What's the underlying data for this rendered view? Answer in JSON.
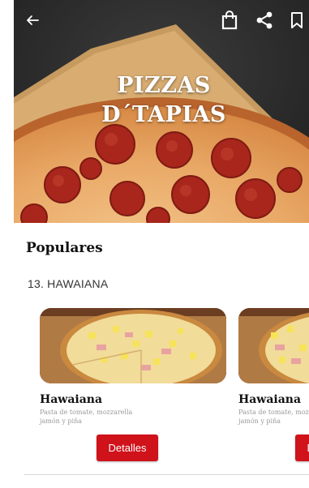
{
  "hero": {
    "title_line1": "PIZZAS",
    "title_line2": "D´TAPIAS"
  },
  "toolbar": {
    "icons": [
      "back-arrow-icon",
      "shopping-bag-icon",
      "share-icon",
      "bookmark-icon"
    ]
  },
  "main": {
    "section_title": "Populares",
    "category_label": "13. HAWAIANA",
    "products": [
      {
        "name": "Hawaiana",
        "description": "Pasta de tomate, mozzarella jamón y piña",
        "button_label": "Detalles"
      },
      {
        "name": "Hawaiana",
        "description": "Pasta de tomate, mozzarella jamón y piña",
        "button_label": "Detalles"
      }
    ]
  },
  "colors": {
    "accent": "#d0121b",
    "hero_background": "#2a2a2a"
  }
}
